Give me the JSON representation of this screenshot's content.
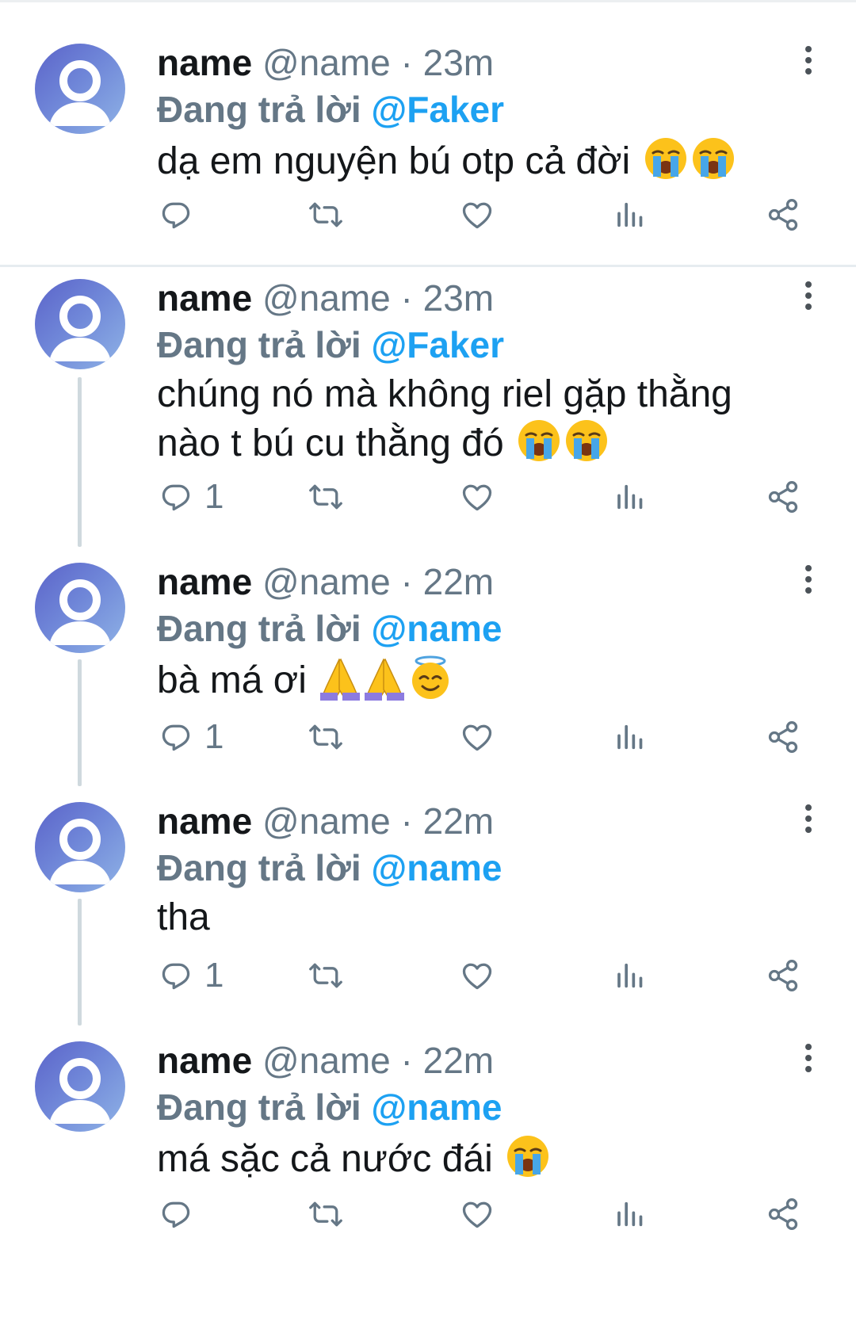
{
  "tweets": [
    {
      "name": "name",
      "handle": "@name",
      "dot": "·",
      "time": "23m",
      "reply_label": "Đang trả lời",
      "reply_to": "@Faker",
      "text": "dạ em nguyện bú otp cả đời",
      "emojis": [
        "loudly-crying-face",
        "loudly-crying-face"
      ],
      "reply_count": ""
    },
    {
      "name": "name",
      "handle": "@name",
      "dot": "·",
      "time": "23m",
      "reply_label": "Đang trả lời",
      "reply_to": "@Faker",
      "text": "chúng nó mà không riel gặp thằng nào t bú cu thằng đó",
      "emojis": [
        "loudly-crying-face",
        "loudly-crying-face"
      ],
      "reply_count": "1"
    },
    {
      "name": "name",
      "handle": "@name",
      "dot": "·",
      "time": "22m",
      "reply_label": "Đang trả lời",
      "reply_to": "@name",
      "text": "bà má ơi",
      "emojis": [
        "folded-hands",
        "folded-hands",
        "smiling-face-with-halo"
      ],
      "reply_count": "1"
    },
    {
      "name": "name",
      "handle": "@name",
      "dot": "·",
      "time": "22m",
      "reply_label": "Đang trả lời",
      "reply_to": "@name",
      "text": "tha",
      "emojis": [],
      "reply_count": "1"
    },
    {
      "name": "name",
      "handle": "@name",
      "dot": "·",
      "time": "22m",
      "reply_label": "Đang trả lời",
      "reply_to": "@name",
      "text": "má sặc cả nước đái",
      "emojis": [
        "loudly-crying-face"
      ],
      "reply_count": ""
    }
  ],
  "icons": {
    "reply": "reply-icon",
    "retweet": "retweet-icon",
    "like": "heart-icon",
    "analytics": "analytics-icon",
    "share": "share-icon",
    "more": "more-options-icon",
    "avatar": "default-avatar-icon"
  },
  "colors": {
    "accent": "#1da1f2",
    "secondary_text": "#657786",
    "primary_text": "#14171a",
    "icon": "#657786"
  }
}
